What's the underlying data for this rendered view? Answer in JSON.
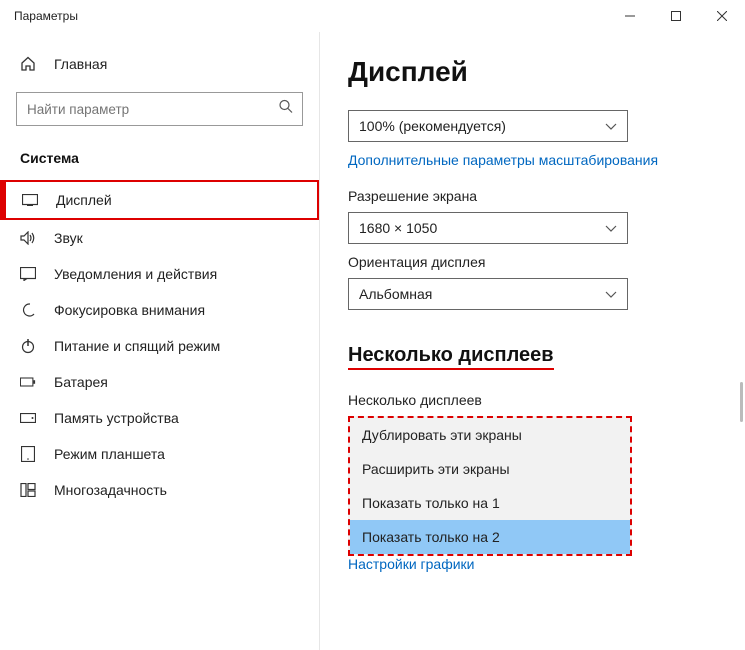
{
  "window": {
    "title": "Параметры"
  },
  "sidebar": {
    "home": "Главная",
    "searchPlaceholder": "Найти параметр",
    "category": "Система",
    "items": [
      {
        "label": "Дисплей"
      },
      {
        "label": "Звук"
      },
      {
        "label": "Уведомления и действия"
      },
      {
        "label": "Фокусировка внимания"
      },
      {
        "label": "Питание и спящий режим"
      },
      {
        "label": "Батарея"
      },
      {
        "label": "Память устройства"
      },
      {
        "label": "Режим планшета"
      },
      {
        "label": "Многозадачность"
      }
    ]
  },
  "content": {
    "title": "Дисплей",
    "scaleValue": "100% (рекомендуется)",
    "scaleLink": "Дополнительные параметры масштабирования",
    "resolutionLabel": "Разрешение экрана",
    "resolutionValue": "1680 × 1050",
    "orientationLabel": "Ориентация дисплея",
    "orientationValue": "Альбомная",
    "multiHeading": "Несколько дисплеев",
    "multiLabel": "Несколько дисплеев",
    "options": [
      "Дублировать эти экраны",
      "Расширить эти экраны",
      "Показать только на 1",
      "Показать только на 2"
    ],
    "graphicsLink": "Настройки графики"
  }
}
